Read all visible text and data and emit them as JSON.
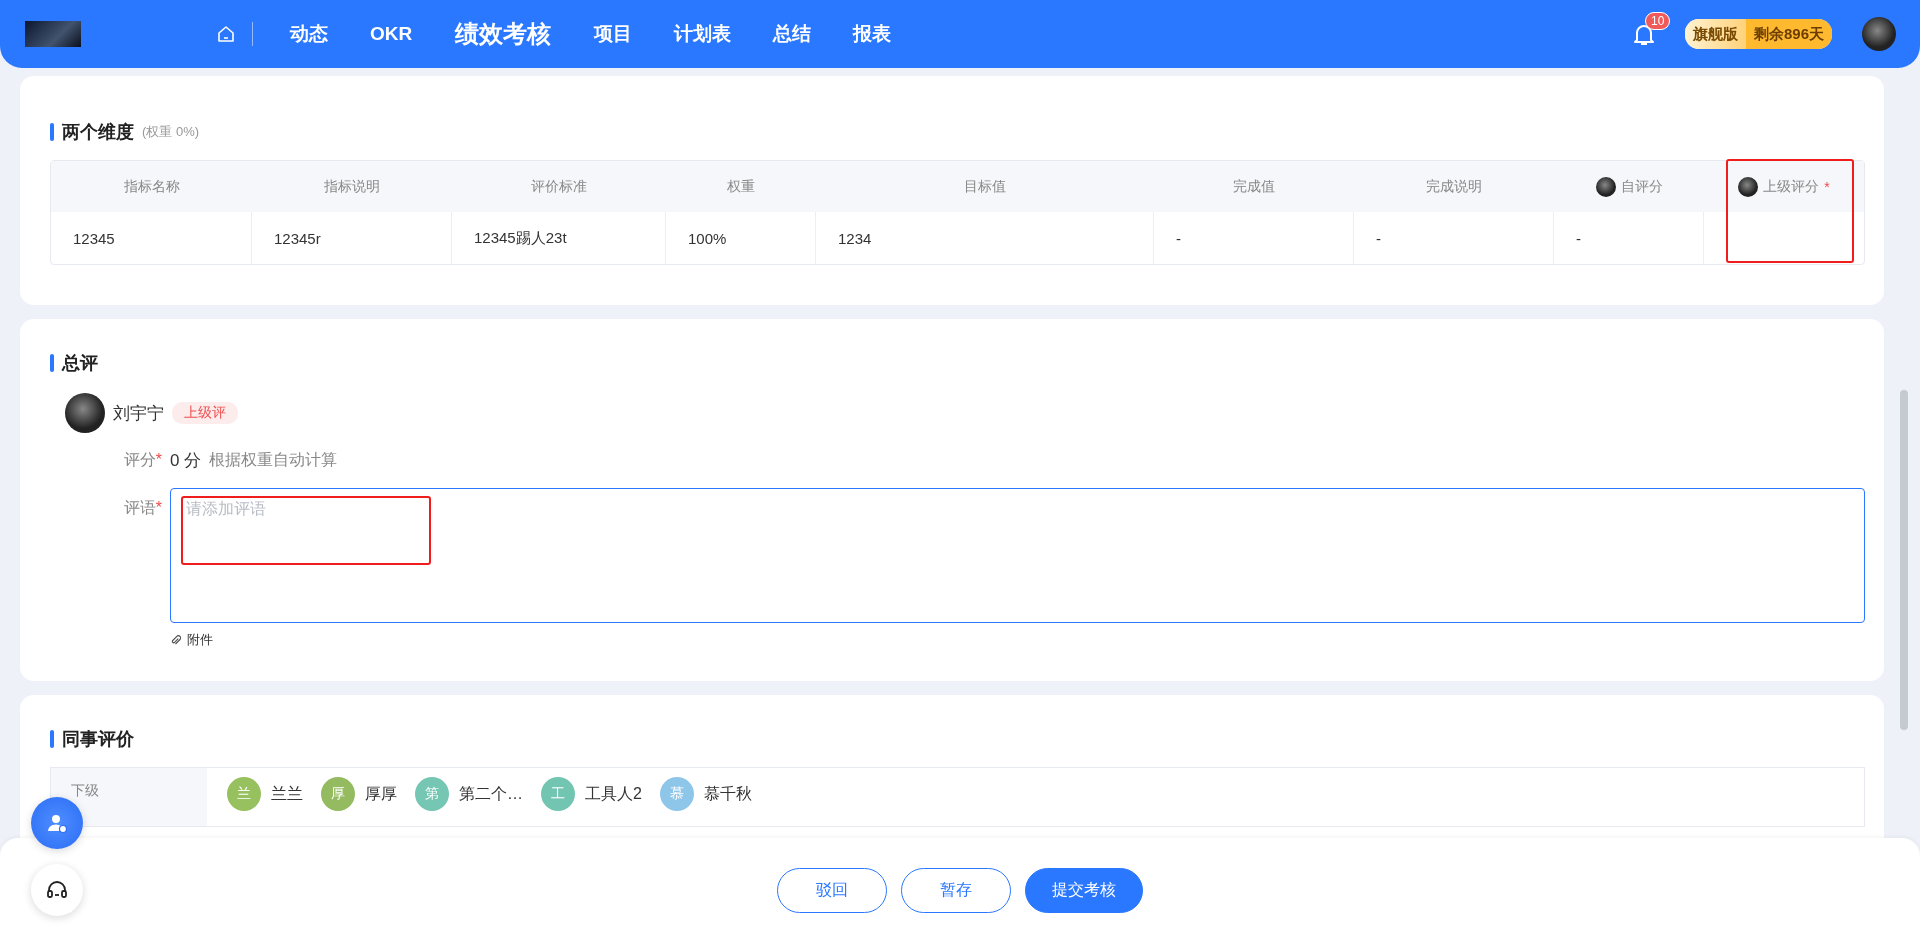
{
  "header": {
    "nav": [
      {
        "label": "动态",
        "selected": false
      },
      {
        "label": "OKR",
        "selected": false
      },
      {
        "label": "绩效考核",
        "selected": true
      },
      {
        "label": "项目",
        "selected": false
      },
      {
        "label": "计划表",
        "selected": false
      },
      {
        "label": "总结",
        "selected": false
      },
      {
        "label": "报表",
        "selected": false
      }
    ],
    "notifications": "10",
    "plan": {
      "edition": "旗舰版",
      "remaining": "剩余896天"
    }
  },
  "dimension": {
    "title": "两个维度",
    "weight": "(权重 0%)",
    "columns": [
      {
        "label": "指标名称",
        "avatar": false,
        "highlighted": false
      },
      {
        "label": "指标说明",
        "avatar": false,
        "highlighted": false
      },
      {
        "label": "评价标准",
        "avatar": false,
        "highlighted": false
      },
      {
        "label": "权重",
        "avatar": false,
        "highlighted": false
      },
      {
        "label": "目标值",
        "avatar": false,
        "highlighted": false
      },
      {
        "label": "完成值",
        "avatar": false,
        "highlighted": false
      },
      {
        "label": "完成说明",
        "avatar": false,
        "highlighted": false
      },
      {
        "label": "自评分",
        "avatar": true,
        "highlighted": false
      },
      {
        "label": "上级评分",
        "avatar": true,
        "highlighted": true,
        "required_mark": "*"
      }
    ],
    "rows": [
      [
        "12345",
        "12345r",
        "12345踢人23t",
        "100%",
        "1234",
        "-",
        "-",
        "-"
      ]
    ]
  },
  "summary": {
    "title": "总评",
    "reviewer": {
      "name": "刘宇宁",
      "role": "上级评"
    },
    "score": {
      "label": "评分",
      "required_mark": "*",
      "value": "0 分",
      "hint": "根据权重自动计算"
    },
    "comment": {
      "label": "评语",
      "required_mark": "*",
      "placeholder": "请添加评语",
      "highlighted": true
    },
    "attachment": "附件"
  },
  "peers": {
    "title": "同事评价",
    "groups": [
      {
        "label": "下级",
        "people": [
          {
            "initial": "兰",
            "name": "兰兰",
            "color": "#97c05f"
          },
          {
            "initial": "厚",
            "name": "厚厚",
            "color": "#94bb5f"
          },
          {
            "initial": "第",
            "name": "第二个…",
            "color": "#75c6b3"
          },
          {
            "initial": "工",
            "name": "工具人2",
            "color": "#72c5b1"
          },
          {
            "initial": "慕",
            "name": "慕千秋",
            "color": "#8ec6ea"
          }
        ]
      }
    ]
  },
  "actions": [
    {
      "label": "驳回",
      "kind": "outline"
    },
    {
      "label": "暂存",
      "kind": "outline"
    },
    {
      "label": "提交考核",
      "kind": "primary"
    }
  ]
}
